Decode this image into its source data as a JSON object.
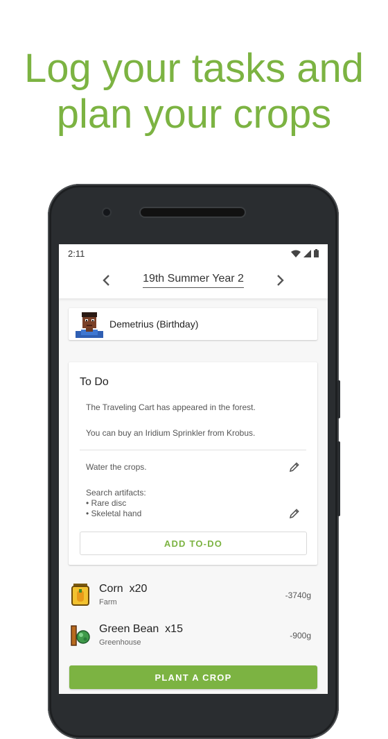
{
  "promo": {
    "headline_line1": "Log your tasks and",
    "headline_line2": "plan your crops",
    "accent_color": "#7cb342"
  },
  "status_bar": {
    "time": "2:11",
    "icons": [
      "wifi-icon",
      "signal-icon",
      "battery-icon"
    ]
  },
  "app_bar": {
    "date": "19th Summer Year 2",
    "prev_icon": "chevron-left-icon",
    "next_icon": "chevron-right-icon"
  },
  "birthday": {
    "label": "Demetrius (Birthday)",
    "icon": "villager-portrait-icon"
  },
  "todo": {
    "title": "To Do",
    "notices": [
      "The Traveling Cart has appeared in the forest.",
      "You can buy an Iridium Sprinkler from Krobus."
    ],
    "items": [
      {
        "text": "Water the crops.",
        "edit_icon": "pencil-icon"
      },
      {
        "title": "Search artifacts:",
        "bullets": [
          "• Rare disc",
          "• Skeletal hand"
        ],
        "edit_icon": "pencil-icon"
      }
    ],
    "add_label": "ADD TO-DO"
  },
  "crops": [
    {
      "name": "Corn  x20",
      "location": "Farm",
      "cost": "-3740g",
      "icon": "corn-seeds-icon"
    },
    {
      "name": "Green Bean  x15",
      "location": "Greenhouse",
      "cost": "-900g",
      "icon": "bean-starter-icon"
    }
  ],
  "plant_button": "PLANT A CROP"
}
